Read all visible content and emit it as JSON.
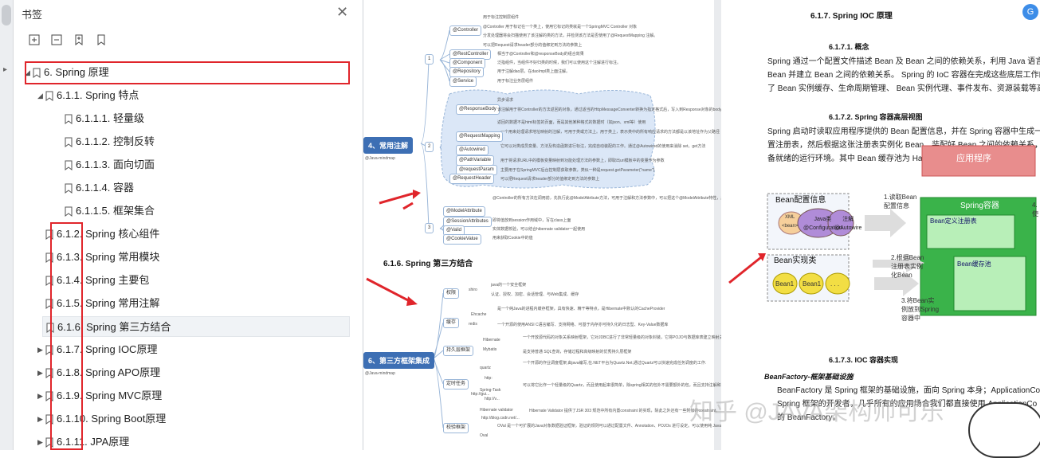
{
  "panel": {
    "title": "书签",
    "items": [
      {
        "label": "6. Spring 原理"
      },
      {
        "label": "6.1.1. Spring 特点"
      },
      {
        "label": "6.1.1.1. 轻量级"
      },
      {
        "label": "6.1.1.2. 控制反转"
      },
      {
        "label": "6.1.1.3. 面向切面"
      },
      {
        "label": "6.1.1.4. 容器"
      },
      {
        "label": "6.1.1.5. 框架集合"
      },
      {
        "label": "6.1.2. Spring 核心组件"
      },
      {
        "label": "6.1.3. Spring 常用模块"
      },
      {
        "label": "6.1.4. Spring 主要包"
      },
      {
        "label": "6.1.5. Spring 常用注解"
      },
      {
        "label": "6.1.6. Spring 第三方结合"
      },
      {
        "label": "6.1.7. Spring IOC原理"
      },
      {
        "label": "6.1.8. Spring APO原理"
      },
      {
        "label": "6.1.9. Spring MVC原理"
      },
      {
        "label": "6.1.10. Spring Boot原理"
      },
      {
        "label": "6.1.11. JPA原理"
      }
    ]
  },
  "page1": {
    "mm1_root": "4、常用注解",
    "mm1_sub": "@Java-mindmap",
    "mm1_nodes": [
      "@Controller",
      "@RestController",
      "@Component",
      "@Repository",
      "@Service",
      "@ResponseBody",
      "@RequestMapping",
      "@Autowired",
      "@PathVariable",
      "@requestParam",
      "@RequestHeader",
      "@ModelAttribute",
      "@SessionAttributes",
      "@Valid",
      "@CookieValue"
    ],
    "mm1_nums": [
      "1",
      "2",
      "3"
    ],
    "mm1_notes": [
      "用于标注控制层组件",
      "@Controller 用于标记在一个类上，使用它标记的类就是一个SpringMVC Controller 对象",
      "分发处理器将会扫描使用了该注解的类的方法，并检测该方法是否使用了@RequestMapping 注解。",
      "可以把Request请求header部分的值绑定到方法的参数上",
      "相当于@Controller和@responseBody的组合效果",
      "泛指组件，当组件不好归类的时候，我们可以使用这个注解进行标注。",
      "用于注解dao层，在daoImpl类上面注解。",
      "用于标注业务层组件",
      "异步请求",
      "该注解用于将Controller的方法返回的对象，通过适当的HttpMessageConverter转换为指定格式后，写入到Response对象的body数据区。",
      "返回的数据不是html标签的页面，而是其他某种格式的数据时（如json、xml等）使用",
      "一个用来处理请求地址映射的注解，可用于类或方法上。用于类上，表示类中的所有响应请求的方法都是以该地址作为父路径",
      "它可以对类成员变量、方法及构造函数进行标注，完成自动装配的工作。通过@Autowired的使用来消除 set，get方法",
      "用于将请求URL中的模板变量映射到功能处理方法的参数上，即取出uri模板中的变量作为参数",
      "主要用于在SpringMVC后台控制层获取参数，类似一种是request.getParameter(\"name\")",
      "可以把Request请求header部分的值绑定到方法的参数上",
      "@Controller的所有方法在调用前，先执行此@ModelAttribute方法，可用于注解和方法参数中，可以把这个@ModelAttribute特性，应用在BaseController当中，所有的Controller继承BaseController，即可实现在调用Controller时，先执行@ModelAttribute方法。",
      "即将值放到session作用域中，写在class上面",
      "实体数据校验，可以结合hibernate validator一起使用",
      "用来获取Cookie中的值"
    ],
    "sec_title": "6.1.6. Spring 第三方结合",
    "mm2_root": "6、第三方框架集成",
    "mm2_sub": "@Java-mindmap",
    "mm2_nodes": [
      "权限",
      "缓存",
      "持久层框架",
      "定时任务",
      "校验框架"
    ],
    "mm2_leaves": [
      "shiro",
      "Ehcache",
      "redis",
      "Hibernate",
      "Mybatis",
      "quartz",
      "Spring-Task",
      "Hibernate validator",
      "Oval"
    ],
    "mm2_notes": [
      "java的一个安全框架",
      "认证、授权、加密、会话管理、与Web集成、缓存",
      "是一个纯Java的进程内缓存框架，具有快速、精干等特点，是Hibernate中默认的CacheProvider",
      "一个开源的使用ANSI C语言编写、支持网络、可基于内存亦可持久化的日志型、Key-Value数据库",
      "一个开放源代码的对象关系映射框架，它对JDBC进行了非常轻量级的对象封装，它将POJO与数据库表建立映射关系，是一个全自动的orm框架",
      "是支持普通 SQL查询，存储过程和高级映射的优秀持久层框架",
      "一个开源的作业调度框架,由java编写,在.NET平台为Quartz.Net,通过Quartz可以快速完成任务调度的工作.",
      "可以将它比作一个轻量级的Quartz，而且使用起来很简单，除spring相关的包外不需要额外的包，而且支持注解和配置文件两种形式",
      "Hibernate Validator 提供了JSR 303 规范中所有内置constraint 的实现，除此之外还有一些附加的constraint。",
      "OVal 是一个可扩展的Java对象数据验证框架，验证的规则可以通过配置文件、Annotation、POJOs 进行设定。可以使用纯 Java 语言、JavaScript 、Groovy 、BeanShell 等进行规则的编写"
    ],
    "mm2_urls": [
      "http:",
      "http://gui...",
      "http://v...",
      "http://blog.csdn.net/..."
    ]
  },
  "page2": {
    "h1": "6.1.7.  Spring IOC 原理",
    "h11": "6.1.7.1.        概念",
    "p1": [
      "Spring 通过一个配置文件描述 Bean 及 Bean 之间的依赖关系，利用 Java 语言的反",
      "Bean 并建立 Bean 之间的依赖关系。 Spring 的 IoC 容器在完成这些底层工作的基",
      "了 Bean 实例缓存、生命周期管理、 Bean 实例代理、事件发布、资源装载等高级服"
    ],
    "h12": "6.1.7.2.        Spring 容器高层视图",
    "p2": [
      "Spring 启动时读取应用程序提供的 Bean 配置信息，并在 Spring 容器中生成一份相",
      "置注册表，然后根据这张注册表实例化 Bean，装配好 Bean 之间的依赖关系，为上",
      "备就绪的运行环境。其中 Bean 缓存池为 HashMap 实现"
    ],
    "diagram": {
      "app": "应用程序",
      "bean_config": "Bean配置信息",
      "xml": "XML\n<bean>",
      "java": "Java类\n@Configuration",
      "anno": "注解\n@Autowire",
      "step1": "1.读取Bean\n配置信息",
      "container": "Spring容器",
      "registry": "Bean定义注册表",
      "step2": "2.根据Bean\n注册表实例\n化Bean",
      "pool": "Bean缓存池",
      "impl": "Bean实现类",
      "bean1": "Bean1",
      "dots": ". . .",
      "step3": "3.将Bean实\n例放到Spring\n容器中",
      "step4": "4.使"
    },
    "h13": "6.1.7.3.        IOC 容器实现",
    "h14": "BeanFactory-框架基础设施",
    "p3": [
      "BeanFactory 是 Spring 框架的基础设施，面向 Spring 本身；ApplicationCon",
      "Spring 框架的开发者，几乎所有的应用场合我们都直接使用 ApplicationCo",
      "的 BeanFactory。"
    ],
    "watermark": "知乎 @JAVA架构师可乐"
  },
  "colors": {
    "red": "#e0252b",
    "accent": "#3d6fb4"
  }
}
